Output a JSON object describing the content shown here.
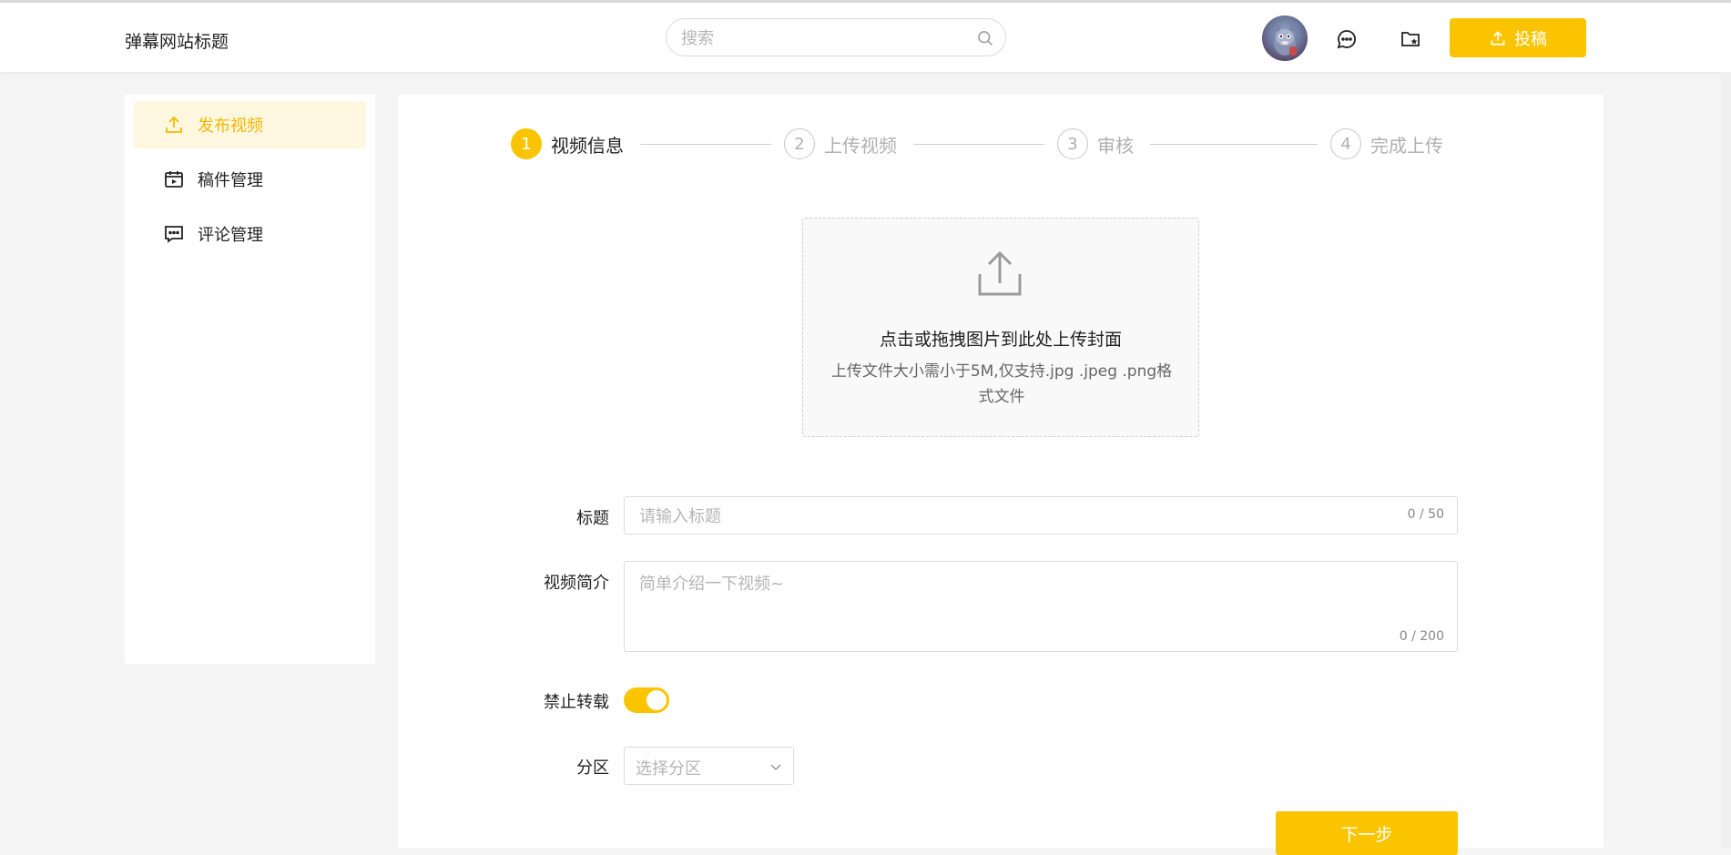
{
  "header": {
    "site_title": "弹幕网站标题",
    "search_placeholder": "搜索",
    "upload_button": "投稿"
  },
  "sidebar": {
    "items": [
      {
        "label": "发布视频",
        "icon": "upload-icon",
        "active": true
      },
      {
        "label": "稿件管理",
        "icon": "video-manage-icon",
        "active": false
      },
      {
        "label": "评论管理",
        "icon": "comment-icon",
        "active": false
      }
    ]
  },
  "steps": [
    {
      "num": "1",
      "label": "视频信息",
      "state": "done"
    },
    {
      "num": "2",
      "label": "上传视频",
      "state": "todo"
    },
    {
      "num": "3",
      "label": "审核",
      "state": "todo"
    },
    {
      "num": "4",
      "label": "完成上传",
      "state": "todo"
    }
  ],
  "cover_upload": {
    "main_text": "点击或拖拽图片到此处上传封面",
    "sub_text": "上传文件大小需小于5M,仅支持.jpg .jpeg .png格式文件"
  },
  "form": {
    "title_label": "标题",
    "title_placeholder": "请输入标题",
    "title_counter": "0 / 50",
    "intro_label": "视频简介",
    "intro_placeholder": "简单介绍一下视频~",
    "intro_counter": "0 / 200",
    "no_repost_label": "禁止转载",
    "no_repost_enabled": true,
    "category_label": "分区",
    "category_placeholder": "选择分区",
    "next_button": "下一步"
  },
  "colors": {
    "accent": "#fbc400",
    "active_bg": "#fff7e0"
  }
}
